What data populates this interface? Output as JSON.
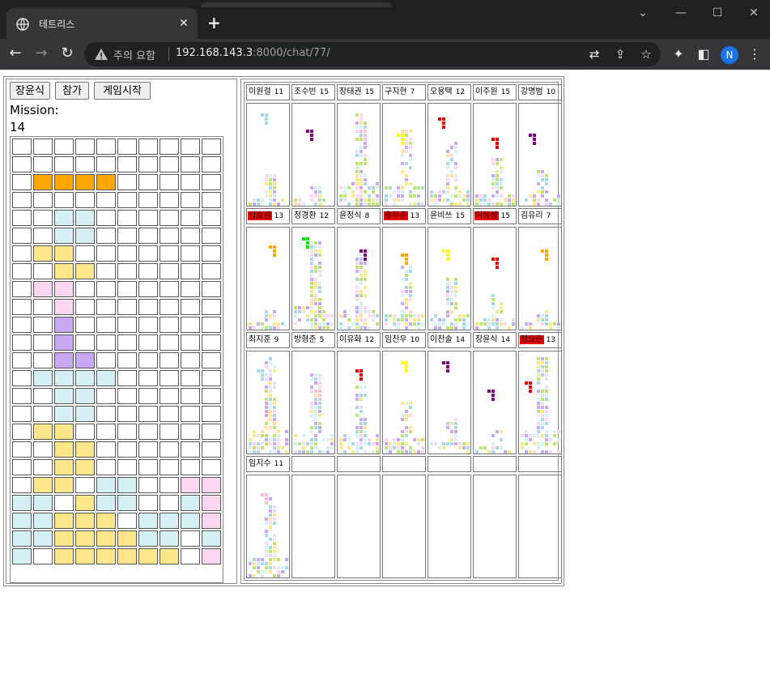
{
  "browser": {
    "tab_title": "테트리스",
    "new_tab": "+",
    "close_tab": "✕",
    "omnibox": {
      "warning": "주의 요함",
      "host": "192.168.143.3",
      "path": ":8000/chat/77/"
    },
    "avatar_letter": "N"
  },
  "game": {
    "player_button": "장윤식",
    "join_button": "참가",
    "start_button": "게임시작",
    "mission_label": "Mission:",
    "mission_value": "14",
    "board_cols": 10,
    "board_rows": 25,
    "colors": {
      "o": "#ffa500",
      "c": "#d4f0f5",
      "y": "#fce68a",
      "p": "#fbd6f0",
      "v": "#c9a8f2",
      "w": "#ffffff",
      "g": "#bde46e",
      "r": "#e60000",
      "m": "#800080",
      "lb": "#a8d8e6",
      "ye": "#ffff00",
      "gr": "#00e600",
      "pk": "#f5c0d8"
    },
    "board": [
      "..........",
      "..........",
      ".oooo.....",
      "..........",
      "..cc......",
      "..cc......",
      ".yy.......",
      "..yy......",
      ".pp.......",
      "..p.......",
      "..v.......",
      "..v.......",
      "..vv......",
      ".cccc.....",
      "..cc......",
      "..cc......",
      ".yy.......",
      "..yy......",
      "..yy......",
      ".yy.cc..pp",
      "cc.ycc..cp",
      "ccyyy.cccp",
      "ccyyyycc.c",
      "c.yyyyyy.p"
    ]
  },
  "players": [
    {
      "name": "이원걸",
      "score": "11",
      "alert": false
    },
    {
      "name": "조수빈",
      "score": "15",
      "alert": false
    },
    {
      "name": "장태권",
      "score": "15",
      "alert": false
    },
    {
      "name": "구지현",
      "score": "7",
      "alert": false
    },
    {
      "name": "오용택",
      "score": "12",
      "alert": false
    },
    {
      "name": "이주원",
      "score": "15",
      "alert": false
    },
    {
      "name": "강명범",
      "score": "10",
      "alert": false
    },
    {
      "name": "김호겸",
      "score": "13",
      "alert": true
    },
    {
      "name": "정경환",
      "score": "12",
      "alert": false
    },
    {
      "name": "윤정식",
      "score": "8",
      "alert": false
    },
    {
      "name": "홍무준",
      "score": "13",
      "alert": true
    },
    {
      "name": "윤비쓰",
      "score": "15",
      "alert": false
    },
    {
      "name": "이유성",
      "score": "15",
      "alert": true
    },
    {
      "name": "김유리",
      "score": "7",
      "alert": false
    },
    {
      "name": "최지훈",
      "score": "9",
      "alert": false
    },
    {
      "name": "방형준",
      "score": "5",
      "alert": false
    },
    {
      "name": "이유화",
      "score": "12",
      "alert": false
    },
    {
      "name": "임찬우",
      "score": "10",
      "alert": false
    },
    {
      "name": "이찬솔",
      "score": "14",
      "alert": false
    },
    {
      "name": "장윤식",
      "score": "14",
      "alert": false
    },
    {
      "name": "정요준",
      "score": "13",
      "alert": true
    },
    {
      "name": "임지수",
      "score": "11",
      "alert": false
    }
  ]
}
